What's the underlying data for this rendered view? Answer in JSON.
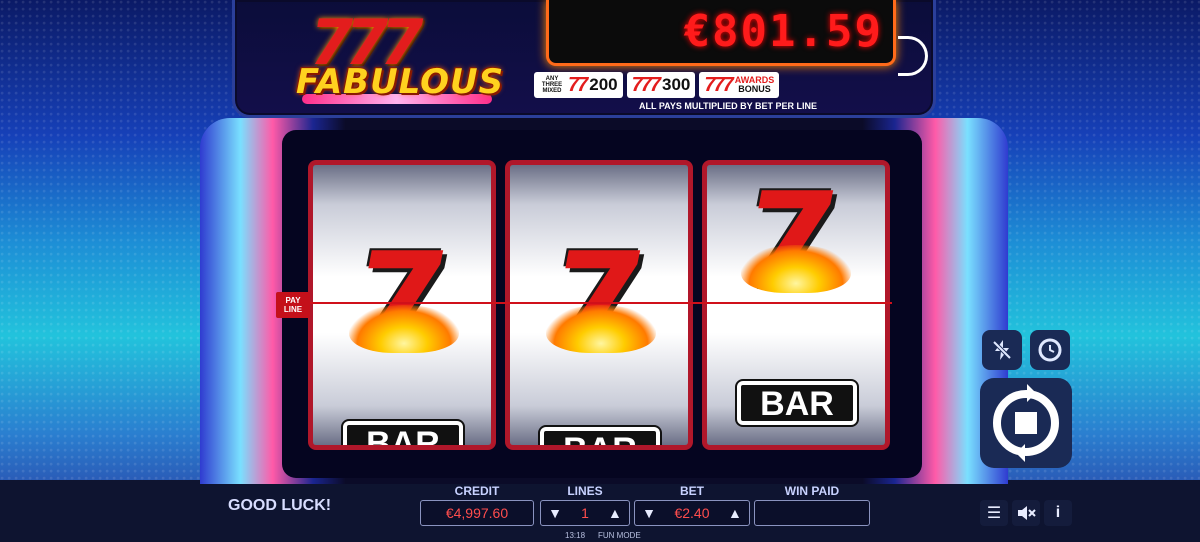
{
  "game": {
    "logo_sevens": "777",
    "logo_text": "FABULOUS"
  },
  "jackpot": {
    "value": "€801.59"
  },
  "paytable": {
    "mixed_note": "ANY THREE MIXED",
    "mixed_sevens": "77",
    "mixed_value": "200",
    "triple_sevens": "777",
    "triple_value": "300",
    "bonus_sevens": "777",
    "bonus_label_1": "AWARDS",
    "bonus_label_2": "BONUS",
    "pays_note": "ALL PAYS MULTIPLIED BY BET PER LINE"
  },
  "reels": {
    "payline_label_1": "PAY",
    "payline_label_2": "LINE",
    "reel1": {
      "middle": "7",
      "bottom": "BAR"
    },
    "reel2": {
      "middle": "7",
      "bottom": "BAR"
    },
    "reel3": {
      "top": "7",
      "bottom": "BAR"
    }
  },
  "status": {
    "message": "GOOD LUCK!"
  },
  "credit": {
    "label": "CREDIT",
    "value": "€4,997.60"
  },
  "lines": {
    "label": "LINES",
    "value": "1"
  },
  "bet": {
    "label": "BET",
    "value": "€2.40"
  },
  "win_paid": {
    "label": "WIN PAID",
    "value": ""
  },
  "footer": {
    "time": "13:18",
    "mode": "FUN MODE"
  },
  "icons": {
    "turbo": "lightning-off-icon",
    "autoplay": "autoplay-icon",
    "spin": "spin-icon",
    "menu": "menu-icon",
    "sound": "sound-muted-icon",
    "info": "info-icon"
  },
  "colors": {
    "accent_red": "#e01818",
    "jackpot_red": "#ff1b1b",
    "frame_orange": "#ff6a1a"
  }
}
